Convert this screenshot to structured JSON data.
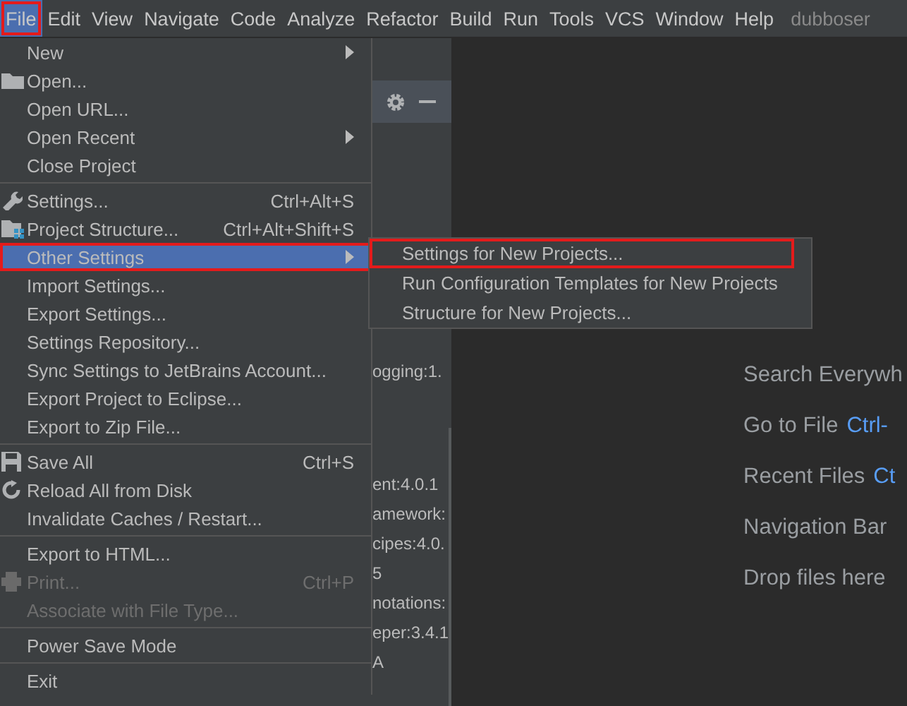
{
  "menu_bar": {
    "items": [
      {
        "label": "File",
        "selected": true,
        "marked": true
      },
      {
        "label": "Edit",
        "selected": false,
        "marked": false
      },
      {
        "label": "View",
        "selected": false,
        "marked": false
      },
      {
        "label": "Navigate",
        "selected": false,
        "marked": false
      },
      {
        "label": "Code",
        "selected": false,
        "marked": false
      },
      {
        "label": "Analyze",
        "selected": false,
        "marked": false
      },
      {
        "label": "Refactor",
        "selected": false,
        "marked": false
      },
      {
        "label": "Build",
        "selected": false,
        "marked": false
      },
      {
        "label": "Run",
        "selected": false,
        "marked": false
      },
      {
        "label": "Tools",
        "selected": false,
        "marked": false
      },
      {
        "label": "VCS",
        "selected": false,
        "marked": false
      },
      {
        "label": "Window",
        "selected": false,
        "marked": false
      },
      {
        "label": "Help",
        "selected": false,
        "marked": false
      }
    ],
    "project_title": "dubboser"
  },
  "project_panel": {
    "lines": [
      "ogging:1.",
      "ent:4.0.1",
      "amework:",
      "cipes:4.0.",
      "5",
      "notations:",
      "eper:3.4.1",
      "A"
    ]
  },
  "file_menu": {
    "groups": [
      [
        {
          "label": "New",
          "submenu": true,
          "selected": false,
          "disabled": false,
          "marked": false
        },
        {
          "label": "Open...",
          "kind": "folder",
          "selected": false,
          "disabled": false,
          "marked": false
        },
        {
          "label": "Open URL...",
          "selected": false,
          "disabled": false,
          "marked": false
        },
        {
          "label": "Open Recent",
          "submenu": true,
          "selected": false,
          "disabled": false,
          "marked": false
        },
        {
          "label": "Close Project",
          "selected": false,
          "disabled": false,
          "marked": false
        }
      ],
      [
        {
          "label": "Settings...",
          "shortcut": "Ctrl+Alt+S",
          "kind": "wrench",
          "selected": false,
          "disabled": false,
          "marked": false
        },
        {
          "label": "Project Structure...",
          "shortcut": "Ctrl+Alt+Shift+S",
          "kind": "structure",
          "selected": false,
          "disabled": false,
          "marked": false
        },
        {
          "label": "Other Settings",
          "submenu": true,
          "selected": true,
          "disabled": false,
          "marked": true
        },
        {
          "label": "Import Settings...",
          "selected": false,
          "disabled": false,
          "marked": false
        },
        {
          "label": "Export Settings...",
          "selected": false,
          "disabled": false,
          "marked": false
        },
        {
          "label": "Settings Repository...",
          "selected": false,
          "disabled": false,
          "marked": false
        },
        {
          "label": "Sync Settings to JetBrains Account...",
          "selected": false,
          "disabled": false,
          "marked": false
        },
        {
          "label": "Export Project to Eclipse...",
          "selected": false,
          "disabled": false,
          "marked": false
        },
        {
          "label": "Export to Zip File...",
          "selected": false,
          "disabled": false,
          "marked": false
        }
      ],
      [
        {
          "label": "Save All",
          "shortcut": "Ctrl+S",
          "kind": "save",
          "selected": false,
          "disabled": false,
          "marked": false
        },
        {
          "label": "Reload All from Disk",
          "kind": "reload",
          "selected": false,
          "disabled": false,
          "marked": false
        },
        {
          "label": "Invalidate Caches / Restart...",
          "selected": false,
          "disabled": false,
          "marked": false
        }
      ],
      [
        {
          "label": "Export to HTML...",
          "selected": false,
          "disabled": false,
          "marked": false
        },
        {
          "label": "Print...",
          "shortcut": "Ctrl+P",
          "kind": "print",
          "selected": false,
          "disabled": true,
          "marked": false
        },
        {
          "label": "Associate with File Type...",
          "selected": false,
          "disabled": true,
          "marked": false
        }
      ],
      [
        {
          "label": "Power Save Mode",
          "selected": false,
          "disabled": false,
          "marked": false
        }
      ],
      [
        {
          "label": "Exit",
          "selected": false,
          "disabled": false,
          "marked": false
        }
      ]
    ]
  },
  "submenu": {
    "items": [
      {
        "label": "Settings for New Projects...",
        "marked": true
      },
      {
        "label": "Run Configuration Templates for New Projects",
        "marked": false
      },
      {
        "label": "Structure for New Projects...",
        "marked": false
      }
    ]
  },
  "editor_hints": [
    {
      "label": "Search Everywh"
    },
    {
      "label": "Go to File",
      "shortcut": "Ctrl-"
    },
    {
      "label": "Recent Files",
      "shortcut": "Ct"
    },
    {
      "label": "Navigation Bar"
    },
    {
      "label": "Drop files here"
    }
  ]
}
